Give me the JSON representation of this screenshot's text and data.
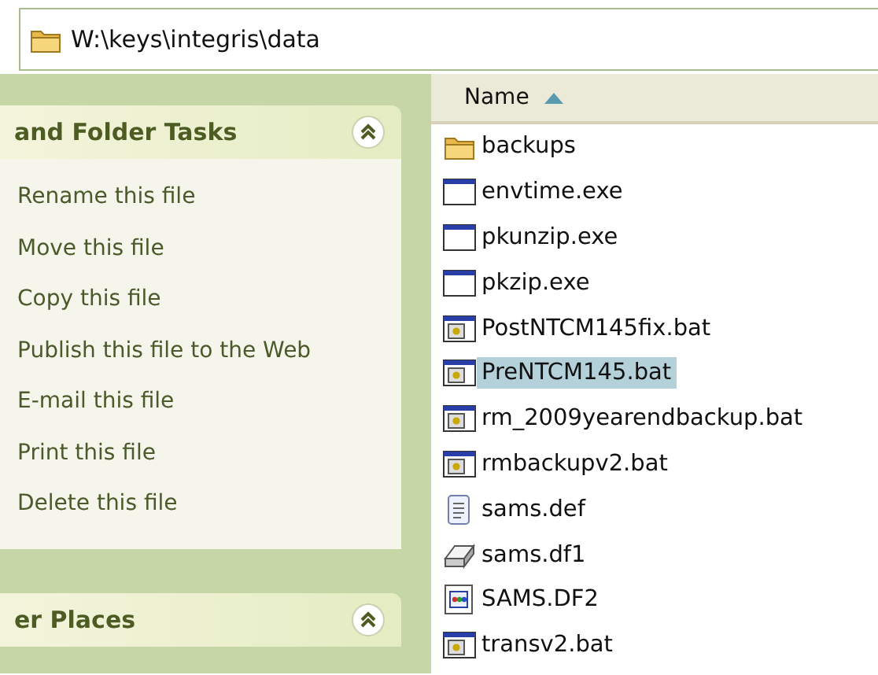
{
  "address_bar": {
    "path": "W:\\keys\\integris\\data"
  },
  "task_panels": [
    {
      "title": "and Folder Tasks",
      "expanded": true,
      "items": [
        "Rename this file",
        "Move this file",
        "Copy this file",
        "Publish this file to the Web",
        "E-mail this file",
        "Print this file",
        "Delete this file"
      ]
    },
    {
      "title": "er Places",
      "expanded": true
    }
  ],
  "file_list": {
    "columns": [
      {
        "label": "Name",
        "sorted": true
      }
    ],
    "files": [
      {
        "name": "backups",
        "kind": "folder",
        "selected": false
      },
      {
        "name": "envtime.exe",
        "kind": "program",
        "selected": false
      },
      {
        "name": "pkunzip.exe",
        "kind": "program",
        "selected": false
      },
      {
        "name": "pkzip.exe",
        "kind": "program",
        "selected": false
      },
      {
        "name": "PostNTCM145fix.bat",
        "kind": "batch",
        "selected": false
      },
      {
        "name": "PreNTCM145.bat",
        "kind": "batch",
        "selected": true
      },
      {
        "name": "rm_2009yearendbackup.bat",
        "kind": "batch",
        "selected": false
      },
      {
        "name": "rmbackupv2.bat",
        "kind": "batch",
        "selected": false
      },
      {
        "name": "sams.def",
        "kind": "text",
        "selected": false
      },
      {
        "name": "sams.df1",
        "kind": "drive",
        "selected": false
      },
      {
        "name": "SAMS.DF2",
        "kind": "app",
        "selected": false
      },
      {
        "name": "transv2.bat",
        "kind": "batch",
        "selected": false
      }
    ]
  }
}
